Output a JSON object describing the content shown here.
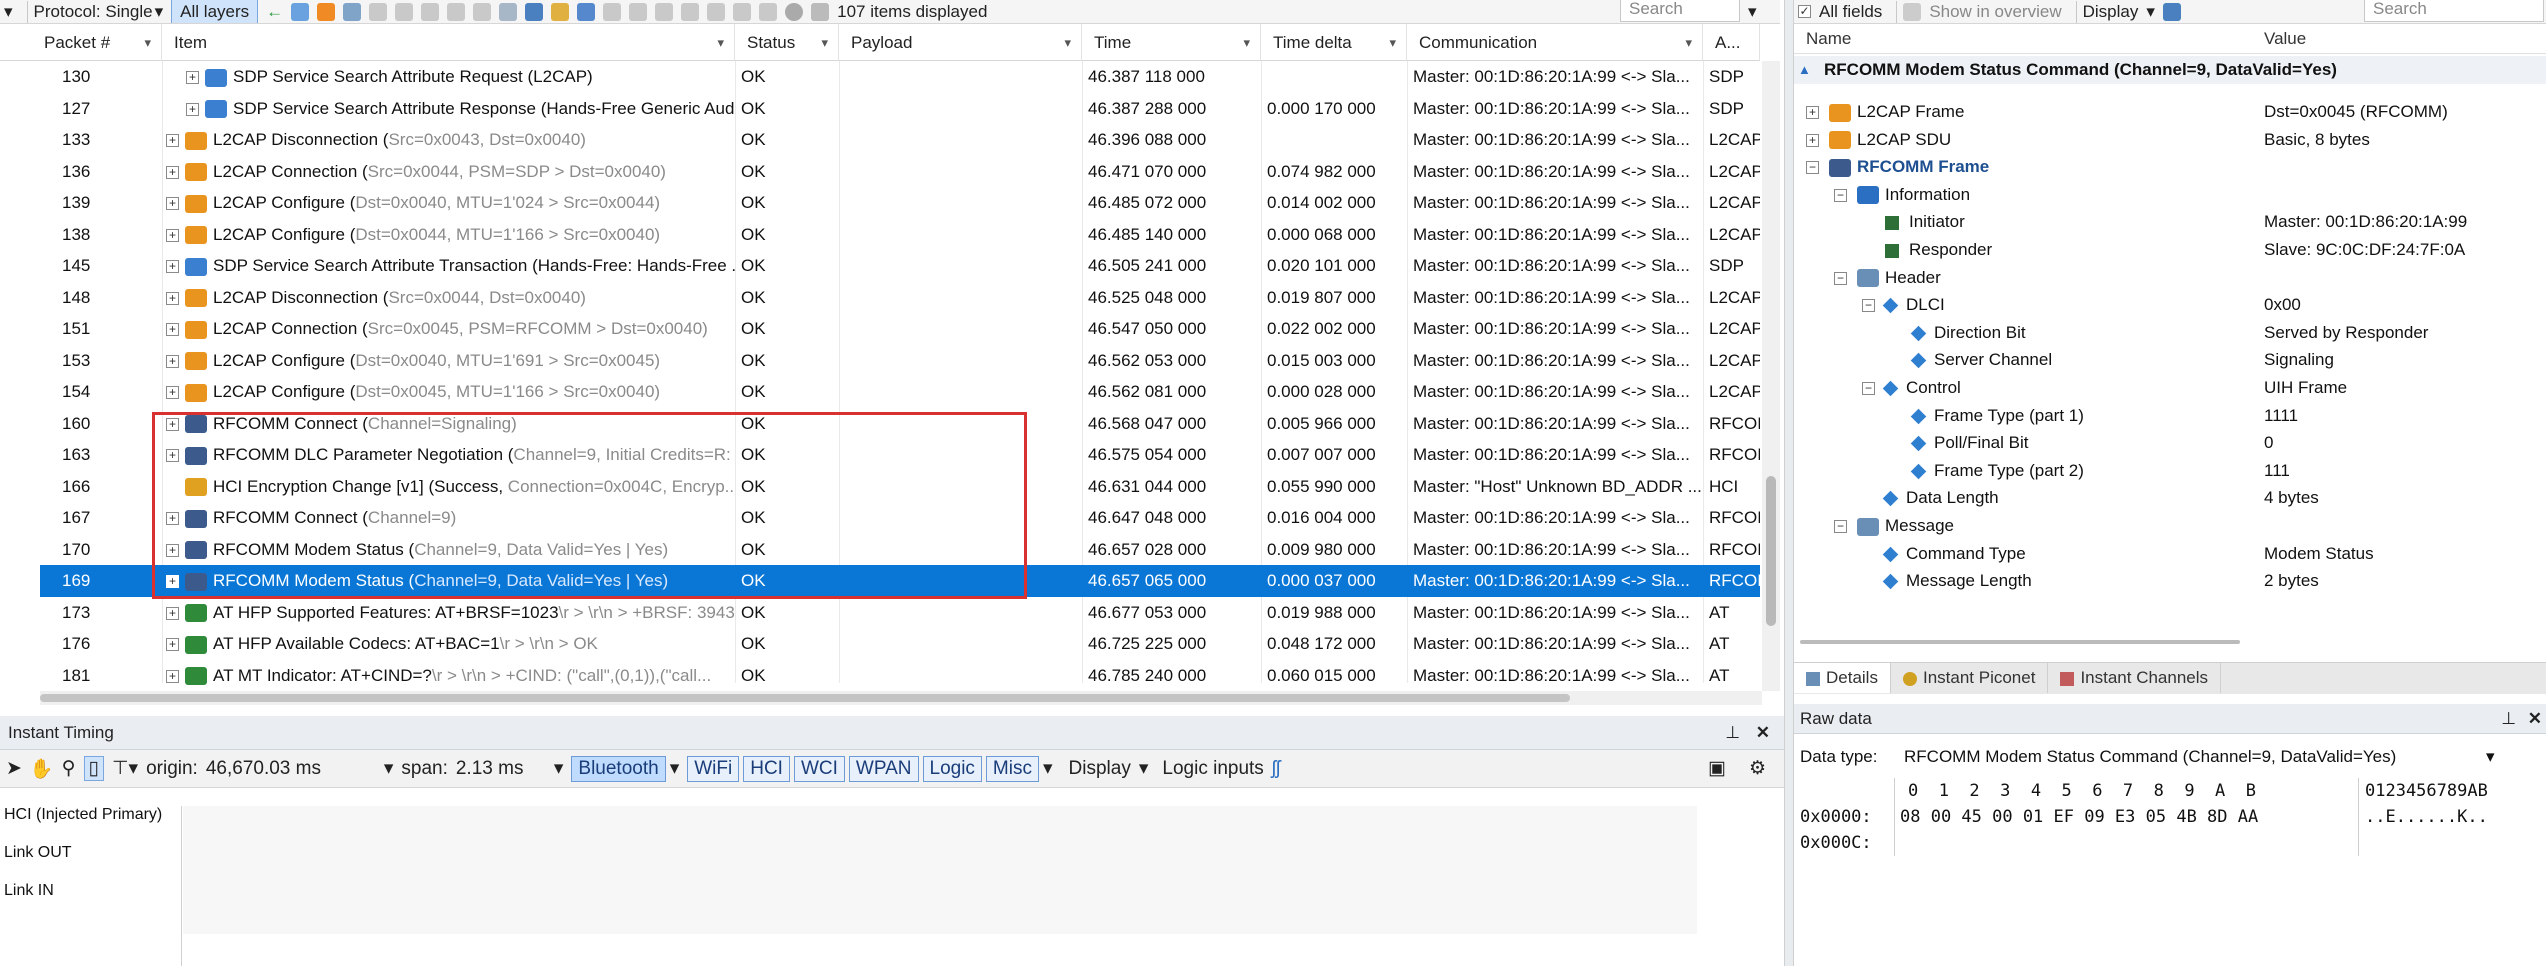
{
  "toolbar": {
    "protocol_label": "Protocol: Single",
    "layers_label": "All layers",
    "items_count": "107 items displayed",
    "search_placeholder": "Search"
  },
  "table": {
    "columns": [
      "Packet #",
      "Item",
      "Status",
      "Payload",
      "Time",
      "Time delta",
      "Communication",
      "A..."
    ],
    "rows": [
      {
        "packet": "130",
        "indent": 2,
        "plus": true,
        "icon": "sdp",
        "item": "SDP Service Search Attribute Request (L2CAP)",
        "gray": "",
        "status": "OK",
        "time": "46.387 118 000",
        "delta": "",
        "comm": "Master: 00:1D:86:20:1A:99 <-> Sla...",
        "layer": "SDP"
      },
      {
        "packet": "127",
        "indent": 2,
        "plus": true,
        "icon": "sdp",
        "item": "SDP Service Search Attribute Response (Hands-Free Generic Aud...",
        "gray": "",
        "status": "OK",
        "time": "46.387 288 000",
        "delta": "0.000 170 000",
        "comm": "Master: 00:1D:86:20:1A:99 <-> Sla...",
        "layer": "SDP"
      },
      {
        "packet": "133",
        "indent": 1,
        "plus": true,
        "icon": "l2cap",
        "item": "L2CAP Disconnection (",
        "gray": "Src=0x0043, Dst=0x0040)",
        "status": "OK",
        "time": "46.396 088 000",
        "delta": "",
        "comm": "Master: 00:1D:86:20:1A:99 <-> Sla...",
        "layer": "L2CAP"
      },
      {
        "packet": "136",
        "indent": 1,
        "plus": true,
        "icon": "l2cap",
        "item": "L2CAP Connection (",
        "gray": "Src=0x0044, PSM=SDP > Dst=0x0040)",
        "status": "OK",
        "time": "46.471 070 000",
        "delta": "0.074 982 000",
        "comm": "Master: 00:1D:86:20:1A:99 <-> Sla...",
        "layer": "L2CAP"
      },
      {
        "packet": "139",
        "indent": 1,
        "plus": true,
        "icon": "l2cap",
        "item": "L2CAP Configure (",
        "gray": "Dst=0x0040, MTU=1'024 > Src=0x0044)",
        "status": "OK",
        "time": "46.485 072 000",
        "delta": "0.014 002 000",
        "comm": "Master: 00:1D:86:20:1A:99 <-> Sla...",
        "layer": "L2CAP"
      },
      {
        "packet": "138",
        "indent": 1,
        "plus": true,
        "icon": "l2cap",
        "item": "L2CAP Configure (",
        "gray": "Dst=0x0044, MTU=1'166 > Src=0x0040)",
        "status": "OK",
        "time": "46.485 140 000",
        "delta": "0.000 068 000",
        "comm": "Master: 00:1D:86:20:1A:99 <-> Sla...",
        "layer": "L2CAP"
      },
      {
        "packet": "145",
        "indent": 1,
        "plus": true,
        "icon": "sdp",
        "item": "SDP Service Search Attribute Transaction (Hands-Free: Hands-Free ...",
        "gray": "",
        "status": "OK",
        "time": "46.505 241 000",
        "delta": "0.020 101 000",
        "comm": "Master: 00:1D:86:20:1A:99 <-> Sla...",
        "layer": "SDP"
      },
      {
        "packet": "148",
        "indent": 1,
        "plus": true,
        "icon": "l2cap",
        "item": "L2CAP Disconnection (",
        "gray": "Src=0x0044, Dst=0x0040)",
        "status": "OK",
        "time": "46.525 048 000",
        "delta": "0.019 807 000",
        "comm": "Master: 00:1D:86:20:1A:99 <-> Sla...",
        "layer": "L2CAP"
      },
      {
        "packet": "151",
        "indent": 1,
        "plus": true,
        "icon": "l2cap",
        "item": "L2CAP Connection (",
        "gray": "Src=0x0045, PSM=RFCOMM > Dst=0x0040)",
        "status": "OK",
        "time": "46.547 050 000",
        "delta": "0.022 002 000",
        "comm": "Master: 00:1D:86:20:1A:99 <-> Sla...",
        "layer": "L2CAP"
      },
      {
        "packet": "153",
        "indent": 1,
        "plus": true,
        "icon": "l2cap",
        "item": "L2CAP Configure (",
        "gray": "Dst=0x0040, MTU=1'691 > Src=0x0045)",
        "status": "OK",
        "time": "46.562 053 000",
        "delta": "0.015 003 000",
        "comm": "Master: 00:1D:86:20:1A:99 <-> Sla...",
        "layer": "L2CAP"
      },
      {
        "packet": "154",
        "indent": 1,
        "plus": true,
        "icon": "l2cap",
        "item": "L2CAP Configure (",
        "gray": "Dst=0x0045, MTU=1'166 > Src=0x0040)",
        "status": "OK",
        "time": "46.562 081 000",
        "delta": "0.000 028 000",
        "comm": "Master: 00:1D:86:20:1A:99 <-> Sla...",
        "layer": "L2CAP"
      },
      {
        "packet": "160",
        "indent": 1,
        "plus": true,
        "icon": "rfcomm",
        "item": "RFCOMM Connect (",
        "gray": "Channel=Signaling)",
        "status": "OK",
        "time": "46.568 047 000",
        "delta": "0.005 966 000",
        "comm": "Master: 00:1D:86:20:1A:99 <-> Sla...",
        "layer": "RFCOI"
      },
      {
        "packet": "163",
        "indent": 1,
        "plus": true,
        "icon": "rfcomm",
        "item": "RFCOMM DLC Parameter Negotiation (",
        "gray": "Channel=9, Initial Credits=R: ...",
        "status": "OK",
        "time": "46.575 054 000",
        "delta": "0.007 007 000",
        "comm": "Master: 00:1D:86:20:1A:99 <-> Sla...",
        "layer": "RFCOI"
      },
      {
        "packet": "166",
        "indent": 1,
        "plus": false,
        "icon": "hci",
        "item": "HCI Encryption Change [v1] (Success, ",
        "gray": "Connection=0x004C, Encryp...",
        "status": "OK",
        "time": "46.631 044 000",
        "delta": "0.055 990 000",
        "comm": "Master: \"Host\" Unknown BD_ADDR ...",
        "layer": "HCI"
      },
      {
        "packet": "167",
        "indent": 1,
        "plus": true,
        "icon": "rfcomm",
        "item": "RFCOMM Connect (",
        "gray": "Channel=9)",
        "status": "OK",
        "time": "46.647 048 000",
        "delta": "0.016 004 000",
        "comm": "Master: 00:1D:86:20:1A:99 <-> Sla...",
        "layer": "RFCOI"
      },
      {
        "packet": "170",
        "indent": 1,
        "plus": true,
        "icon": "rfcomm",
        "item": "RFCOMM Modem Status (",
        "gray": "Channel=9, Data Valid=Yes | Yes)",
        "status": "OK",
        "time": "46.657 028 000",
        "delta": "0.009 980 000",
        "comm": "Master: 00:1D:86:20:1A:99 <-> Sla...",
        "layer": "RFCOI"
      },
      {
        "packet": "169",
        "indent": 1,
        "plus": true,
        "icon": "rfcomm",
        "item": "RFCOMM Modem Status (",
        "gray": "Channel=9, Data Valid=Yes | Yes)",
        "status": "OK",
        "time": "46.657 065 000",
        "delta": "0.000 037 000",
        "comm": "Master: 00:1D:86:20:1A:99 <-> Sla...",
        "layer": "RFCOI",
        "selected": true
      },
      {
        "packet": "173",
        "indent": 1,
        "plus": true,
        "icon": "at",
        "item": "AT HFP Supported Features: AT+BRSF=1023",
        "gray": "\\r > \\r\\n > +BRSF: 3943",
        "status": "OK",
        "time": "46.677 053 000",
        "delta": "0.019 988 000",
        "comm": "Master: 00:1D:86:20:1A:99 <-> Sla...",
        "layer": "AT"
      },
      {
        "packet": "176",
        "indent": 1,
        "plus": true,
        "icon": "at",
        "item": "AT HFP Available Codecs: AT+BAC=1",
        "gray": "\\r > \\r\\n > OK",
        "status": "OK",
        "time": "46.725 225 000",
        "delta": "0.048 172 000",
        "comm": "Master: 00:1D:86:20:1A:99 <-> Sla...",
        "layer": "AT"
      },
      {
        "packet": "181",
        "indent": 1,
        "plus": true,
        "icon": "at",
        "item": "AT MT Indicator: AT+CIND=?",
        "gray": "\\r > \\r\\n > +CIND: (\"call\",(0,1)),(\"call...",
        "status": "OK",
        "time": "46.785 240 000",
        "delta": "0.060 015 000",
        "comm": "Master: 00:1D:86:20:1A:99 <-> Sla...",
        "layer": "AT"
      }
    ]
  },
  "right_panel": {
    "tabs_top": [
      "All fields",
      "Show in overview",
      "Display"
    ],
    "search_placeholder": "Search",
    "col_name": "Name",
    "col_value": "Value",
    "title": "RFCOMM Modem Status Command (Channel=9, DataValid=Yes)",
    "tree": [
      {
        "level": 0,
        "box": "plus",
        "icon": "l2cap",
        "name": "L2CAP Frame",
        "value": "Dst=0x0045 (RFCOMM)"
      },
      {
        "level": 0,
        "box": "plus",
        "icon": "l2cap",
        "name": "L2CAP SDU",
        "value": "Basic, 8 bytes"
      },
      {
        "level": 0,
        "box": "minus",
        "icon": "rfcomm",
        "name": "RFCOMM Frame",
        "value": "",
        "bold": true
      },
      {
        "level": 1,
        "box": "minus",
        "icon": "info",
        "name": "Information",
        "value": ""
      },
      {
        "level": 2,
        "box": "",
        "icon": "green",
        "name": "Initiator",
        "value": "Master: 00:1D:86:20:1A:99"
      },
      {
        "level": 2,
        "box": "",
        "icon": "green",
        "name": "Responder",
        "value": "Slave: 9C:0C:DF:24:7F:0A"
      },
      {
        "level": 1,
        "box": "minus",
        "icon": "header",
        "name": "Header",
        "value": ""
      },
      {
        "level": 2,
        "box": "minus",
        "icon": "diamond",
        "name": "DLCI",
        "value": "0x00"
      },
      {
        "level": 3,
        "box": "",
        "icon": "diamond",
        "name": "Direction Bit",
        "value": "Served by Responder"
      },
      {
        "level": 3,
        "box": "",
        "icon": "diamond",
        "name": "Server Channel",
        "value": "Signaling"
      },
      {
        "level": 2,
        "box": "minus",
        "icon": "diamond",
        "name": "Control",
        "value": "UIH Frame"
      },
      {
        "level": 3,
        "box": "",
        "icon": "diamond",
        "name": "Frame Type (part 1)",
        "value": "1111"
      },
      {
        "level": 3,
        "box": "",
        "icon": "diamond",
        "name": "Poll/Final Bit",
        "value": "0"
      },
      {
        "level": 3,
        "box": "",
        "icon": "diamond",
        "name": "Frame Type (part 2)",
        "value": "111"
      },
      {
        "level": 2,
        "box": "",
        "icon": "diamond",
        "name": "Data Length",
        "value": "4 bytes"
      },
      {
        "level": 1,
        "box": "minus",
        "icon": "header",
        "name": "Message",
        "value": ""
      },
      {
        "level": 2,
        "box": "",
        "icon": "diamond",
        "name": "Command Type",
        "value": "Modem Status"
      },
      {
        "level": 2,
        "box": "",
        "icon": "diamond",
        "name": "Message Length",
        "value": "2 bytes"
      }
    ],
    "bottom_tabs": [
      "Details",
      "Instant Piconet",
      "Instant Channels"
    ]
  },
  "raw_data": {
    "title": "Raw data",
    "data_type_label": "Data type:",
    "data_type_value": "RFCOMM Modem Status Command (Channel=9, DataValid=Yes)",
    "hex_header": "0  1  2  3  4  5  6  7  8  9  A  B",
    "ascii_header": "0123456789AB",
    "line1_addr": "0x0000:",
    "line1_hex": "08 00 45 00 01 EF 09 E3 05 4B 8D AA",
    "line1_ascii": "..E......K..",
    "line2_addr": "0x000C:"
  },
  "timing": {
    "title": "Instant Timing",
    "origin_label": "origin:",
    "origin_value": "46,670.03 ms",
    "span_label": "span:",
    "span_value": "2.13 ms",
    "filters": [
      "Bluetooth",
      "WiFi",
      "HCI",
      "WCI",
      "WPAN",
      "Logic",
      "Misc"
    ],
    "display_label": "Display",
    "logic_inputs_label": "Logic inputs",
    "lanes": [
      "HCI (Injected Primary)",
      "Link OUT",
      "Link IN"
    ]
  }
}
